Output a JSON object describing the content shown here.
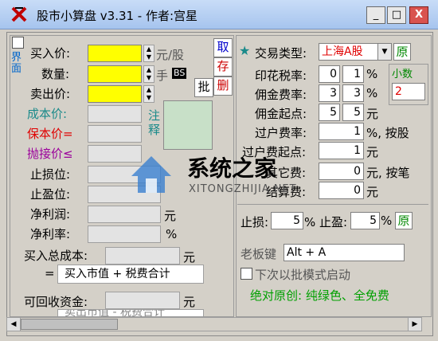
{
  "title": "股市小算盘 v3.31 - 作者:宫星",
  "titlebar": {
    "minimize": "_",
    "maximize": "□",
    "close": "X"
  },
  "left": {
    "side_label": "界面",
    "buy_price": "买入价:",
    "quantity": "数量:",
    "sell_price": "卖出价:",
    "unit_yuan_per_share": "元/股",
    "unit_hand": "手",
    "bs_badge": "BS",
    "cost_price": "成本价:",
    "breakeven_price": "保本价=",
    "catch_price": "抛接价≤",
    "stop_loss": "止损位:",
    "take_profit": "止盈位:",
    "net_profit": "净利润:",
    "net_rate": "净利率:",
    "unit_yuan": "元",
    "unit_percent": "%",
    "total_cost": "买入总成本:",
    "total_cost_unit": "元",
    "formula_eq": "=",
    "formula_text": "买入市值 + 税费合计",
    "recover": "可回收资金:",
    "recover_unit": "元",
    "partial_text": "卖出市值 - 税费合计",
    "btn_take": "取",
    "btn_save": "存",
    "btn_delete": "删",
    "btn_batch": "批",
    "note_label": "注释"
  },
  "right": {
    "trade_type_label": "交易类型:",
    "trade_type_value": "上海A股",
    "origin_btn": "原",
    "stamp_tax": "印花税率:",
    "stamp_a": "0",
    "stamp_b": "1",
    "commission_rate": "佣金费率:",
    "comm_a": "3",
    "comm_b": "3",
    "commission_min": "佣金起点:",
    "cmin_a": "5",
    "cmin_b": "5",
    "transfer_rate": "过户费率:",
    "tr_val": "1",
    "transfer_min": "过户费起点:",
    "tmin_val": "1",
    "other_fee": "其它费:",
    "other_val": "0",
    "settle_fee": "结算费:",
    "settle_val": "0",
    "pct_sym": "%",
    "yuan_sym": "元",
    "per_share_hint": "%, 按股",
    "per_trade_hint": "元, 按笔",
    "small_box_title": "小数",
    "small_box_value": "2",
    "stop_loss_label": "止损:",
    "stop_loss_val": "5",
    "stop_profit_label": "% 止盈:",
    "stop_profit_val": "5",
    "boss_key_label": "老板键",
    "boss_key_value": "Alt + A",
    "batch_start": "下次以批模式启动",
    "slogan": "绝对原创: 纯绿色、全免费",
    "orig_btn2": "原"
  },
  "watermark": {
    "text": "系统之家",
    "sub": "XITONGZHIJIA.NET"
  }
}
